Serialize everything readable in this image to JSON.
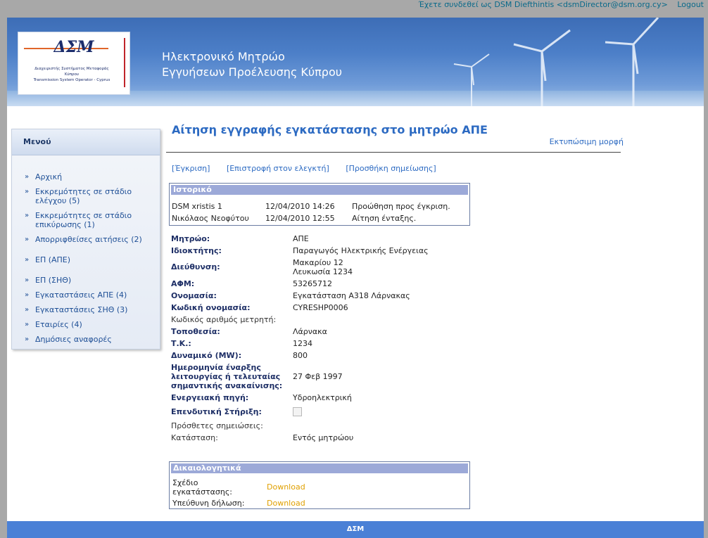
{
  "topbar": {
    "logged_in": "Έχετε συνδεθεί ως DSM Diefthintis <dsmDirector@dsm.org.cy>",
    "logout": "Logout"
  },
  "banner": {
    "logo_text": "ΔΣΜ",
    "logo_sub1": "Διαχειριστής Συστήματος Μεταφοράς",
    "logo_sub2": "Κύπρου",
    "logo_sub3": "Transmission System Operator - Cyprus",
    "title_line1": "Ηλεκτρονικό Μητρώο",
    "title_line2": "Εγγυήσεων Προέλευσης Κύπρου"
  },
  "sidebar": {
    "title": "Μενού",
    "items": [
      {
        "label": "Αρχική"
      },
      {
        "label": "Εκκρεμότητες σε στάδιο ελέγχου (5)"
      },
      {
        "label": "Εκκρεμότητες σε στάδιο επικύρωσης (1)"
      },
      {
        "label": "Απορριφθείσες αιτήσεις (2)"
      },
      {
        "label": "ΕΠ (ΑΠΕ)"
      },
      {
        "label": "ΕΠ (ΣΗΘ)"
      },
      {
        "label": "Εγκαταστάσεις ΑΠΕ (4)"
      },
      {
        "label": "Εγκαταστάσεις ΣΗΘ (3)"
      },
      {
        "label": "Εταιρίες (4)"
      },
      {
        "label": "Δημόσιες αναφορές"
      }
    ]
  },
  "main": {
    "title": "Αίτηση εγγραφής εγκατάστασης στο μητρώο ΑΠΕ",
    "print_link": "Εκτυπώσιμη μορφή",
    "actions": [
      "[Έγκριση]",
      "[Επιστροφή στον ελεγκτή]",
      "[Προσθήκη σημείωσης]"
    ],
    "history": {
      "title": "Ιστορικό",
      "rows": [
        {
          "user": "DSM xristis 1",
          "date": "12/04/2010 14:26",
          "action": "Προώθηση προς έγκριση."
        },
        {
          "user": "Νικόλαος Νεοφύτου",
          "date": "12/04/2010 12:55",
          "action": "Αίτηση ένταξης."
        }
      ]
    },
    "fields": [
      {
        "key": "Μητρώο:",
        "value": "ΑΠΕ"
      },
      {
        "key": "Ιδιοκτήτης:",
        "value": "Παραγωγός Ηλεκτρικής Ενέργειας"
      },
      {
        "key": "Διεύθυνση:",
        "value": "Μακαρίου 12",
        "value2": "Λευκωσία 1234"
      },
      {
        "key": "ΑΦΜ:",
        "value": "53265712"
      },
      {
        "key": "Ονομασία:",
        "value": "Εγκατάσταση Α318 Λάρνακας"
      },
      {
        "key": "Κωδική ονομασία:",
        "value": "CYRESHP0006"
      },
      {
        "key": "Κωδικός αριθμός μετρητή:",
        "value": ""
      },
      {
        "key": "Τοποθεσία:",
        "value": "Λάρνακα"
      },
      {
        "key": "Τ.Κ.:",
        "value": "1234"
      },
      {
        "key": "Δυναμικό (MW):",
        "value": "800"
      },
      {
        "key": "Ημερομηνία έναρξης λειτουργίας ή τελευταίας σημαντικής ανακαίνισης:",
        "value": "27 Φεβ 1997"
      },
      {
        "key": "Ενεργειακή πηγή:",
        "value": "Υδροηλεκτρική"
      },
      {
        "key": "Επενδυτική Στήριξη:",
        "value": ""
      },
      {
        "key": "Πρόσθετες σημειώσεις:",
        "value": ""
      },
      {
        "key": "Κατάσταση:",
        "value": "Εντός μητρώου"
      }
    ],
    "docs": {
      "title": "Δικαιολογητικά",
      "rows": [
        {
          "label": "Σχέδιο εγκατάστασης:",
          "link": "Download"
        },
        {
          "label": "Υπεύθυνη δήλωση:",
          "link": "Download"
        }
      ]
    }
  },
  "footer": {
    "text": "ΔΣΜ"
  },
  "colors": {
    "accent": "#2c6ac2",
    "footer": "#4a80d6",
    "download": "#e0a000"
  }
}
